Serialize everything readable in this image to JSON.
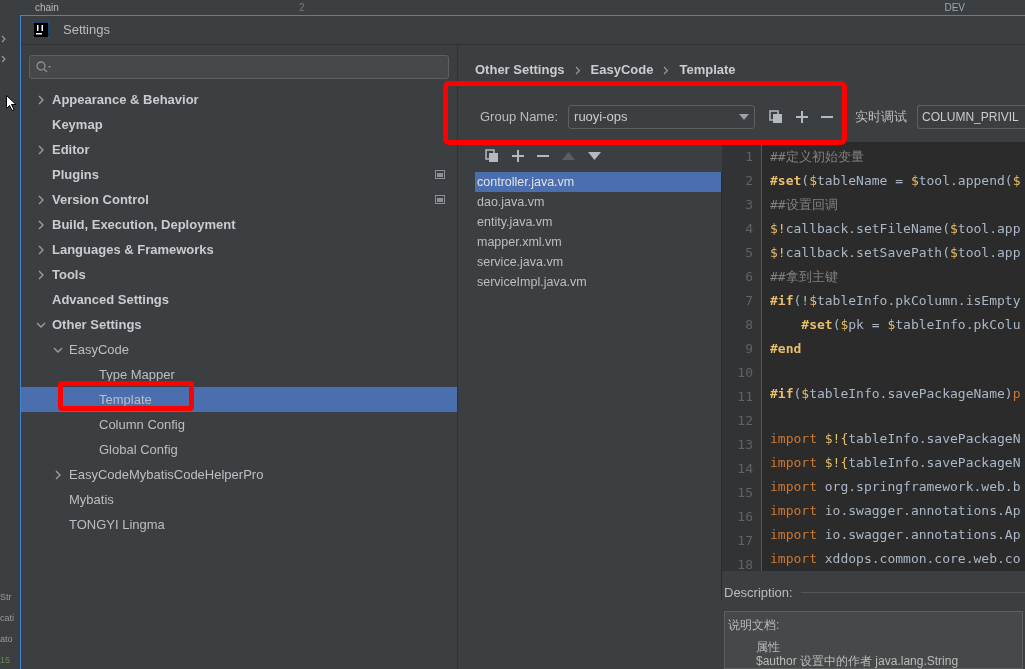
{
  "background_ide": {
    "top_texts": [
      "chain",
      "2",
      "DEV"
    ],
    "side_texts": [
      "Str",
      "cati",
      "ato",
      "15"
    ]
  },
  "window": {
    "title": "Settings"
  },
  "tree": [
    {
      "label": "Appearance & Behavior",
      "expanded": false,
      "project_level": false
    },
    {
      "label": "Keymap",
      "project_level": false
    },
    {
      "label": "Editor",
      "expanded": false,
      "project_level": false
    },
    {
      "label": "Plugins",
      "project_level": true
    },
    {
      "label": "Version Control",
      "expanded": false,
      "project_level": true
    },
    {
      "label": "Build, Execution, Deployment",
      "expanded": false,
      "project_level": false
    },
    {
      "label": "Languages & Frameworks",
      "expanded": false,
      "project_level": false
    },
    {
      "label": "Tools",
      "expanded": false,
      "project_level": false
    },
    {
      "label": "Advanced Settings",
      "project_level": false
    },
    {
      "label": "Other Settings",
      "expanded": true,
      "project_level": false,
      "children": [
        {
          "label": "EasyCode",
          "expanded": true,
          "children": [
            {
              "label": "Type Mapper",
              "selected": false,
              "highlighted": false
            },
            {
              "label": "Template",
              "selected": true,
              "highlighted": true
            },
            {
              "label": "Column Config",
              "selected": false,
              "highlighted": false
            },
            {
              "label": "Global Config",
              "selected": false,
              "highlighted": false
            }
          ]
        },
        {
          "label": "EasyCodeMybatisCodeHelperPro",
          "expanded": false
        },
        {
          "label": "Mybatis"
        },
        {
          "label": "TONGYI Lingma"
        }
      ]
    }
  ],
  "breadcrumb": [
    "Other Settings",
    "EasyCode",
    "Template"
  ],
  "group": {
    "label": "Group Name:",
    "value": "ruoyi-ops",
    "highlighted": true
  },
  "debug": {
    "label": "实时调试",
    "value": "COLUMN_PRIVIL"
  },
  "group_tools": [
    {
      "kind": "copy",
      "disabled": false
    },
    {
      "kind": "add",
      "disabled": false
    },
    {
      "kind": "remove",
      "disabled": false
    }
  ],
  "list_tools": [
    {
      "kind": "copy",
      "disabled": false
    },
    {
      "kind": "add",
      "disabled": false
    },
    {
      "kind": "remove",
      "disabled": false
    },
    {
      "kind": "up",
      "disabled": true
    },
    {
      "kind": "down",
      "disabled": false
    }
  ],
  "templates": [
    {
      "name": "controller.java.vm",
      "selected": true
    },
    {
      "name": "dao.java.vm",
      "selected": false
    },
    {
      "name": "entity.java.vm",
      "selected": false
    },
    {
      "name": "mapper.xml.vm",
      "selected": false
    },
    {
      "name": "service.java.vm",
      "selected": false
    },
    {
      "name": "serviceImpl.java.vm",
      "selected": false
    }
  ],
  "code": [
    {
      "n": "1",
      "tokens": [
        {
          "kind": "comment",
          "text": "##定义初始变量"
        }
      ]
    },
    {
      "n": "2",
      "tokens": [
        {
          "kind": "directive",
          "text": "#set"
        },
        {
          "kind": "text",
          "text": "("
        },
        {
          "kind": "dollar",
          "text": "$"
        },
        {
          "kind": "text",
          "text": "tableName = "
        },
        {
          "kind": "dollar",
          "text": "$"
        },
        {
          "kind": "text",
          "text": "tool.append("
        },
        {
          "kind": "dollar",
          "text": "$"
        }
      ]
    },
    {
      "n": "3",
      "tokens": [
        {
          "kind": "comment",
          "text": "##设置回调"
        }
      ]
    },
    {
      "n": "4",
      "tokens": [
        {
          "kind": "dollar",
          "text": "$!"
        },
        {
          "kind": "text",
          "text": "callback.setFileName("
        },
        {
          "kind": "dollar",
          "text": "$"
        },
        {
          "kind": "text",
          "text": "tool.app"
        }
      ]
    },
    {
      "n": "5",
      "tokens": [
        {
          "kind": "dollar",
          "text": "$!"
        },
        {
          "kind": "text",
          "text": "callback.setSavePath("
        },
        {
          "kind": "dollar",
          "text": "$"
        },
        {
          "kind": "text",
          "text": "tool.app"
        }
      ]
    },
    {
      "n": "6",
      "tokens": [
        {
          "kind": "comment",
          "text": "##拿到主键"
        }
      ]
    },
    {
      "n": "7",
      "tokens": [
        {
          "kind": "directive",
          "text": "#if"
        },
        {
          "kind": "text",
          "text": "(!"
        },
        {
          "kind": "dollar",
          "text": "$"
        },
        {
          "kind": "text",
          "text": "tableInfo.pkColumn.isEmpty"
        }
      ]
    },
    {
      "n": "8",
      "tokens": [
        {
          "kind": "directive",
          "text": "    #set"
        },
        {
          "kind": "text",
          "text": "("
        },
        {
          "kind": "dollar",
          "text": "$"
        },
        {
          "kind": "text",
          "text": "pk = "
        },
        {
          "kind": "dollar",
          "text": "$"
        },
        {
          "kind": "text",
          "text": "tableInfo.pkColu"
        }
      ]
    },
    {
      "n": "9",
      "tokens": [
        {
          "kind": "directive",
          "text": "#end"
        }
      ]
    },
    {
      "n": "10"
    },
    {
      "n": "11",
      "tokens": [
        {
          "kind": "directive",
          "text": "#if"
        },
        {
          "kind": "text",
          "text": "("
        },
        {
          "kind": "dollar",
          "text": "$"
        },
        {
          "kind": "text",
          "text": "tableInfo.savePackageName)"
        },
        {
          "kind": "keyword",
          "text": "p"
        }
      ]
    },
    {
      "n": "12"
    },
    {
      "n": "13",
      "tokens": [
        {
          "kind": "keyword",
          "text": "import "
        },
        {
          "kind": "dollar",
          "text": "$!{"
        },
        {
          "kind": "text",
          "text": "tableInfo.savePackageN"
        }
      ]
    },
    {
      "n": "14",
      "tokens": [
        {
          "kind": "keyword",
          "text": "import "
        },
        {
          "kind": "dollar",
          "text": "$!{"
        },
        {
          "kind": "text",
          "text": "tableInfo.savePackageN"
        }
      ]
    },
    {
      "n": "15",
      "tokens": [
        {
          "kind": "keyword",
          "text": "import "
        },
        {
          "kind": "text",
          "text": "org.springframework.web.b"
        }
      ]
    },
    {
      "n": "16",
      "tokens": [
        {
          "kind": "keyword",
          "text": "import "
        },
        {
          "kind": "text",
          "text": "io.swagger.annotations.Ap"
        }
      ]
    },
    {
      "n": "17",
      "tokens": [
        {
          "kind": "keyword",
          "text": "import "
        },
        {
          "kind": "text",
          "text": "io.swagger.annotations.Ap"
        }
      ]
    },
    {
      "n": "18",
      "tokens": [
        {
          "kind": "keyword",
          "text": "import "
        },
        {
          "kind": "text",
          "text": "xddops.common.core.web.co"
        }
      ]
    }
  ],
  "description": {
    "label": "Description:",
    "doc_title": "说明文档:",
    "lines": [
      "属性",
      "$author 设置中的作者 java.lang.String"
    ]
  }
}
